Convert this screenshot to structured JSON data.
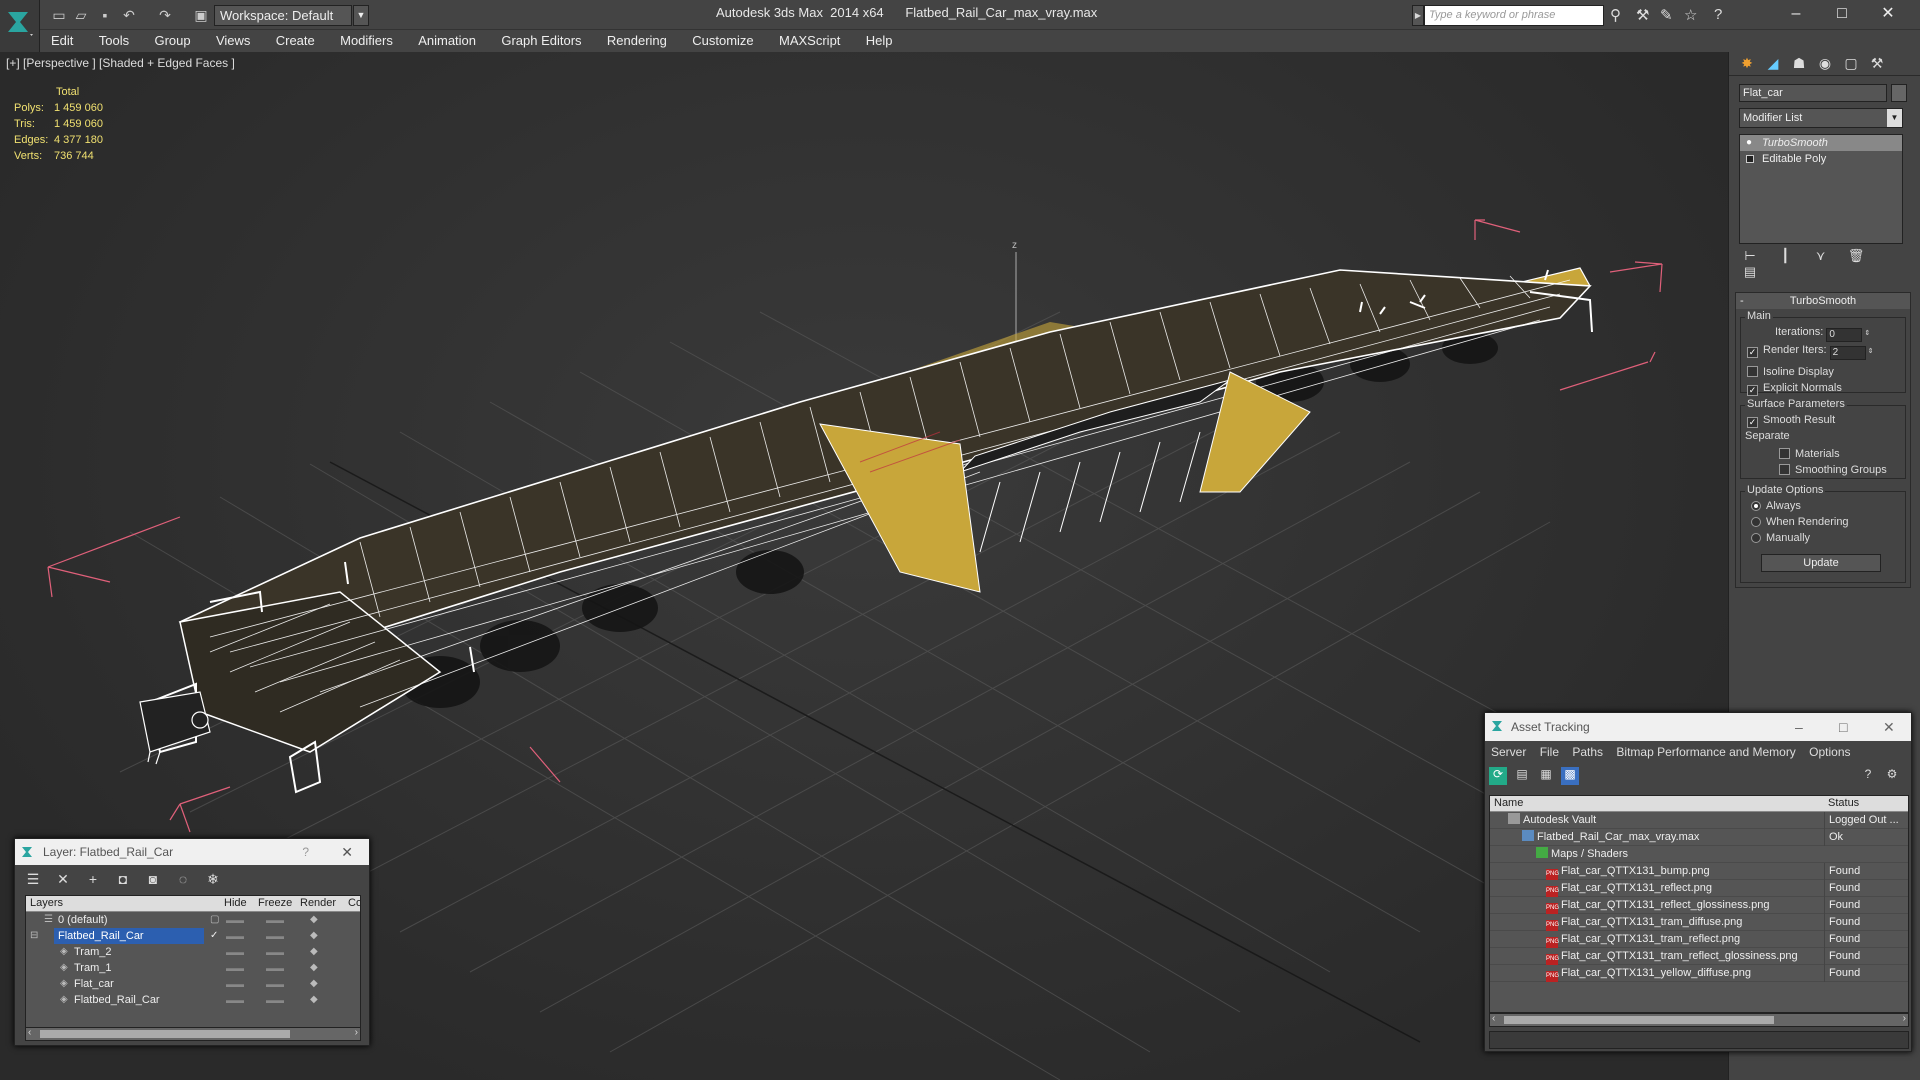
{
  "titlebar": {
    "workspace": "Workspace: Default",
    "app_title": "Autodesk 3ds Max  2014 x64      Flatbed_Rail_Car_max_vray.max",
    "search_placeholder": "Type a keyword or phrase"
  },
  "menu": [
    "Edit",
    "Tools",
    "Group",
    "Views",
    "Create",
    "Modifiers",
    "Animation",
    "Graph Editors",
    "Rendering",
    "Customize",
    "MAXScript",
    "Help"
  ],
  "viewport": {
    "label": "[+] [Perspective ] [Shaded + Edged Faces ]",
    "stats": {
      "header": "Total",
      "rows": [
        {
          "label": "Polys:",
          "value": "1 459 060"
        },
        {
          "label": "Tris:",
          "value": "1 459 060"
        },
        {
          "label": "Edges:",
          "value": "4 377 180"
        },
        {
          "label": "Verts:",
          "value": "736 744"
        }
      ]
    },
    "axis_label": "z"
  },
  "command_panel": {
    "object_name": "Flat_car",
    "modifier_list": "Modifier List",
    "stack": [
      "TurboSmooth",
      "Editable Poly"
    ],
    "rollout_title": "TurboSmooth",
    "main_group": "Main",
    "iterations_label": "Iterations:",
    "iterations_value": "0",
    "render_iters_label": "Render Iters:",
    "render_iters_value": "2",
    "isoline_label": "Isoline Display",
    "explicit_normals_label": "Explicit Normals",
    "surface_group": "Surface Parameters",
    "smooth_result_label": "Smooth Result",
    "separate_label": "Separate",
    "materials_label": "Materials",
    "smoothing_groups_label": "Smoothing Groups",
    "update_group": "Update Options",
    "always_label": "Always",
    "when_rendering_label": "When Rendering",
    "manually_label": "Manually",
    "update_button": "Update"
  },
  "layer_window": {
    "title": "Layer: Flatbed_Rail_Car",
    "help": "?",
    "columns": [
      "Layers",
      "Hide",
      "Freeze",
      "Render",
      "Co"
    ],
    "rows": [
      {
        "name": "0 (default)"
      },
      {
        "name": "Flatbed_Rail_Car"
      },
      {
        "name": "Tram_2"
      },
      {
        "name": "Tram_1"
      },
      {
        "name": "Flat_car"
      },
      {
        "name": "Flatbed_Rail_Car"
      }
    ]
  },
  "asset_window": {
    "title": "Asset Tracking",
    "menu": [
      "Server",
      "File",
      "Paths",
      "Bitmap Performance and Memory",
      "Options"
    ],
    "columns": [
      "Name",
      "Status"
    ],
    "rows": [
      {
        "name": "Autodesk Vault",
        "status": "Logged Out ..."
      },
      {
        "name": "Flatbed_Rail_Car_max_vray.max",
        "status": "Ok"
      },
      {
        "name": "Maps / Shaders",
        "status": ""
      },
      {
        "name": "Flat_car_QTTX131_bump.png",
        "status": "Found"
      },
      {
        "name": "Flat_car_QTTX131_reflect.png",
        "status": "Found"
      },
      {
        "name": "Flat_car_QTTX131_reflect_glossiness.png",
        "status": "Found"
      },
      {
        "name": "Flat_car_QTTX131_tram_diffuse.png",
        "status": "Found"
      },
      {
        "name": "Flat_car_QTTX131_tram_reflect.png",
        "status": "Found"
      },
      {
        "name": "Flat_car_QTTX131_tram_reflect_glossiness.png",
        "status": "Found"
      },
      {
        "name": "Flat_car_QTTX131_yellow_diffuse.png",
        "status": "Found"
      }
    ]
  },
  "colors": {
    "stats_text": "#f0e070",
    "wire_white": "#ffffff",
    "car_yellow": "#c8a63a",
    "bbox_pink": "#e0607a",
    "selection_blue": "#2c5fb0"
  }
}
